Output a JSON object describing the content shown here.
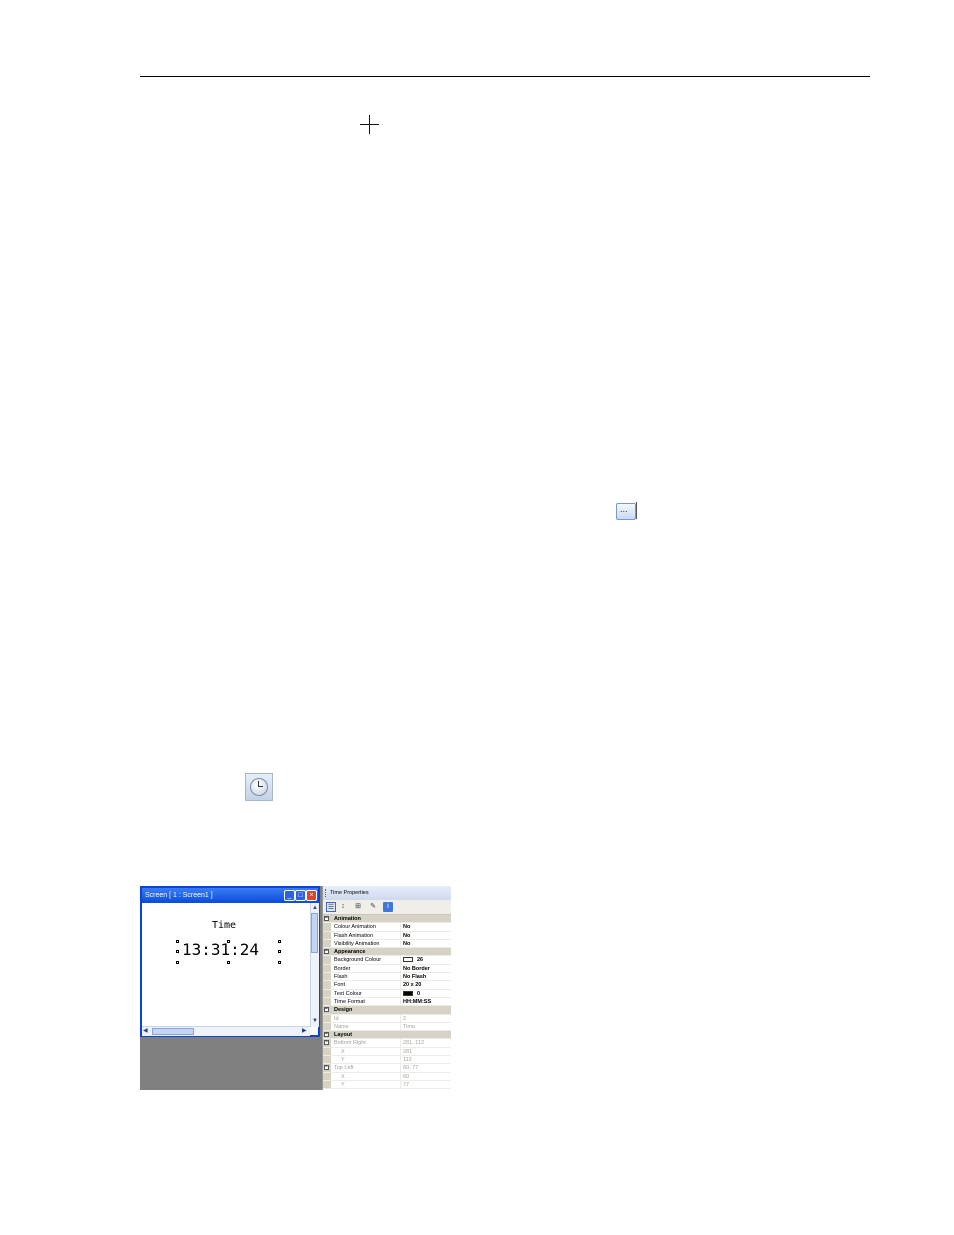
{
  "colors": {
    "titlebar": "#0a46d6",
    "canvas_bg": "#ffffff",
    "screen_bg": "#808080",
    "category_bg": "#d6d3c6",
    "text_colour_swatch": "#000000",
    "background_colour_swatch": "#ffffff"
  },
  "icons": {
    "crosshair": "crosshair-cursor-icon",
    "ellipsis_button": "ellipsis-button-icon",
    "time_tool": "clock-icon"
  },
  "ellipsis_button_label": "...",
  "screen_window": {
    "title": "Screen [ 1 : Screen1 ]",
    "minimize": "_",
    "maximize": "□",
    "close": "×",
    "time_label": "Time",
    "time_value": "13:31:24"
  },
  "properties": {
    "title": "Time Properties",
    "categories": [
      {
        "name": "Animation",
        "rows": [
          {
            "name": "Colour Animation",
            "value": "No"
          },
          {
            "name": "Flash Animation",
            "value": "No"
          },
          {
            "name": "Visibility Animation",
            "value": "No"
          }
        ]
      },
      {
        "name": "Appearance",
        "rows": [
          {
            "name": "Background Colour",
            "value": "26"
          },
          {
            "name": "Border",
            "value": "No Border"
          },
          {
            "name": "Flash",
            "value": "No Flash"
          },
          {
            "name": "Font",
            "value": "20 x 20"
          },
          {
            "name": "Text Colour",
            "value": "0"
          },
          {
            "name": "Time Format",
            "value": "HH:MM:SS"
          }
        ]
      },
      {
        "name": "Design",
        "rows": [
          {
            "name": "Id",
            "value": "2"
          },
          {
            "name": "Name",
            "value": "Time"
          }
        ]
      },
      {
        "name": "Layout",
        "rows": [
          {
            "name": "Bottom Right",
            "value": "281, 112"
          },
          {
            "name": "X",
            "value": "281"
          },
          {
            "name": "Y",
            "value": "112"
          },
          {
            "name": "Top Left",
            "value": "60, 77"
          },
          {
            "name": "X",
            "value": "60"
          },
          {
            "name": "Y",
            "value": "77"
          }
        ]
      }
    ]
  }
}
